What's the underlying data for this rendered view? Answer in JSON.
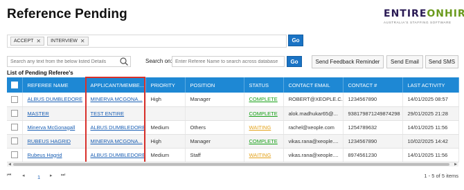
{
  "page": {
    "title": "Reference Pending"
  },
  "logo": {
    "word_part1": "ENTIRE",
    "word_part2": "ONHIRE",
    "tagline": "AUSTRALIA'S STAFFING SOFTWARE"
  },
  "filters": {
    "chips": [
      {
        "label": "ACCEPT"
      },
      {
        "label": "INTERVIEW"
      }
    ],
    "go_label": "Go"
  },
  "search": {
    "placeholder": "Search any text from the below listed Details",
    "on_label": "Search on:",
    "referee_placeholder": "Enter Referee Name to search across database",
    "go_label": "Go"
  },
  "actions": {
    "feedback": "Send Feedback Reminder",
    "email": "Send Email",
    "sms": "Send SMS"
  },
  "list": {
    "title": "List of Pending Referee's"
  },
  "table": {
    "columns": [
      "REFEREE NAME",
      "APPLICANT/MEMBE...",
      "PRIORITY",
      "POSITION",
      "STATUS",
      "CONTACT EMAIL",
      "CONTACT #",
      "LAST ACTIVITY"
    ],
    "rows": [
      {
        "referee": "ALBUS DUMBLEDORE",
        "applicant": "MINERVA MCGONA...",
        "priority": "High",
        "position": "Manager",
        "status": "COMPLETE",
        "email": "ROBERT@XEOPLE.C...",
        "contact": "1234567890",
        "activity": "14/01/2025 08:57"
      },
      {
        "referee": "MASTER",
        "applicant": "TEST ENTIRE",
        "priority": "",
        "position": "",
        "status": "COMPLETE",
        "email": "alok.madhukar65@...",
        "contact": "938179871249874298",
        "activity": "29/01/2025 21:28"
      },
      {
        "referee": "Minerva McGonagall",
        "applicant": "ALBUS DUMBLEDORE",
        "priority": "Medium",
        "position": "Others",
        "status": "WAITING",
        "email": "rachel@xeople.com",
        "contact": "1254789632",
        "activity": "14/01/2025 11:56"
      },
      {
        "referee": "RUBEUS HAGRID",
        "applicant": "MINERVA MCGONA...",
        "priority": "High",
        "position": "Manager",
        "status": "COMPLETE",
        "email": "vikas.rana@xeople....",
        "contact": "1234567890",
        "activity": "10/02/2025 14:42"
      },
      {
        "referee": "Rubeus Hagrid",
        "applicant": "ALBUS DUMBLEDORE",
        "priority": "Medium",
        "position": "Staff",
        "status": "WAITING",
        "email": "vikas.rana@xeople....",
        "contact": "8974561230",
        "activity": "14/01/2025 11:56"
      }
    ]
  },
  "pager": {
    "current_page": "1",
    "summary": "1 - 5 of 5 items"
  },
  "colors": {
    "header_blue": "#1e88d4",
    "go_blue": "#1a73c4",
    "complete_green": "#17a017",
    "waiting_amber": "#e3a21a",
    "highlight_red": "#d9302a"
  }
}
